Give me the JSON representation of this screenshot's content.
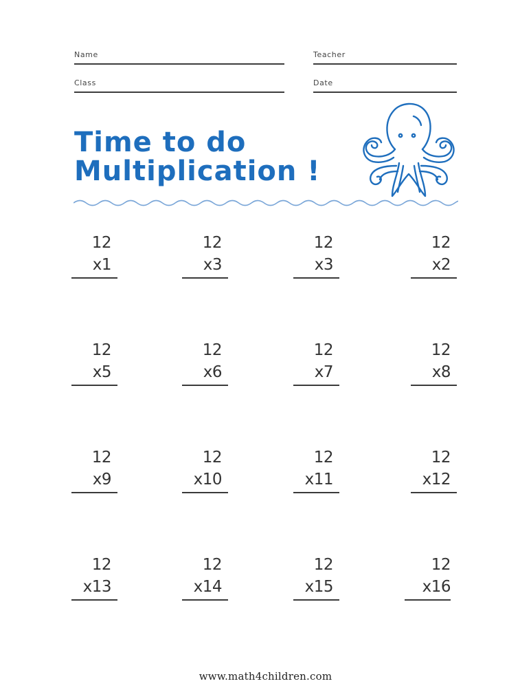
{
  "header_fields": {
    "name_label": "Name",
    "teacher_label": "Teacher",
    "class_label": "Class",
    "date_label": "Date"
  },
  "title": {
    "line1": "Time to do",
    "line2": "Multiplication !",
    "color": "#1e6ebd"
  },
  "decoration": {
    "mascot_icon": "octopus-icon",
    "divider": "wave-divider",
    "wave_color": "#7aa6d8"
  },
  "problems": [
    {
      "top": "12",
      "bottom": "x1"
    },
    {
      "top": "12",
      "bottom": "x3"
    },
    {
      "top": "12",
      "bottom": "x3"
    },
    {
      "top": "12",
      "bottom": "x2"
    },
    {
      "top": "12",
      "bottom": "x5"
    },
    {
      "top": "12",
      "bottom": "x6"
    },
    {
      "top": "12",
      "bottom": "x7"
    },
    {
      "top": "12",
      "bottom": "x8"
    },
    {
      "top": "12",
      "bottom": "x9"
    },
    {
      "top": "12",
      "bottom": "x10"
    },
    {
      "top": "12",
      "bottom": "x11"
    },
    {
      "top": "12",
      "bottom": "x12"
    },
    {
      "top": "12",
      "bottom": "x13"
    },
    {
      "top": "12",
      "bottom": "x14"
    },
    {
      "top": "12",
      "bottom": "x15"
    },
    {
      "top": "12",
      "bottom": "x16"
    }
  ],
  "footer": {
    "website": "www.math4children.com"
  }
}
